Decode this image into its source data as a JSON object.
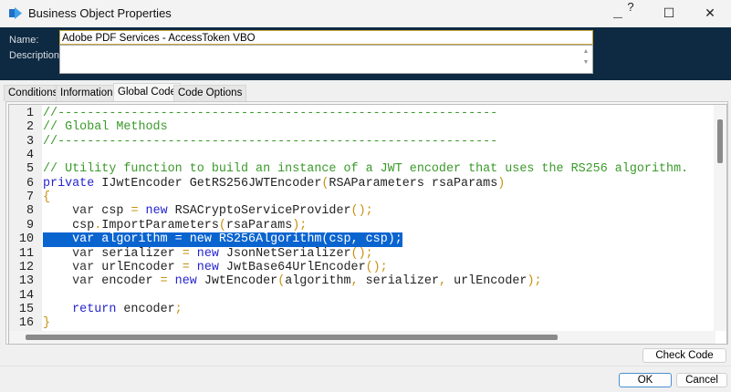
{
  "window": {
    "title": "Business Object Properties",
    "help": "?",
    "minimize": "—",
    "maximize": "☐",
    "close": "✕"
  },
  "header": {
    "name_label": "Name:",
    "description_label": "Description:",
    "name_value": "Adobe PDF Services - AccessToken VBO",
    "description_value": "",
    "desc_up": "▲",
    "desc_down": "▼"
  },
  "tabs": [
    {
      "label": "Conditions"
    },
    {
      "label": "Information"
    },
    {
      "label": "Global Code",
      "active": true
    },
    {
      "label": "Code Options"
    }
  ],
  "code": {
    "selected_line": 10,
    "lines": [
      [
        [
          "c",
          "//------------------------------------------------------------"
        ]
      ],
      [
        [
          "c",
          "// Global Methods"
        ]
      ],
      [
        [
          "c",
          "//------------------------------------------------------------"
        ]
      ],
      [],
      [
        [
          "c",
          "// Utility function to build an instance of a JWT encoder that uses the RS256 algorithm."
        ]
      ],
      [
        [
          "k",
          "private"
        ],
        [
          "i",
          " IJwtEncoder GetRS256JWTEncoder"
        ],
        [
          "o",
          "("
        ],
        [
          "i",
          "RSAParameters rsaParams"
        ],
        [
          "o",
          ")"
        ]
      ],
      [
        [
          "o",
          "{"
        ]
      ],
      [
        [
          "v",
          "    var"
        ],
        [
          "i",
          " csp "
        ],
        [
          "o",
          "="
        ],
        [
          "i",
          " "
        ],
        [
          "k",
          "new"
        ],
        [
          "i",
          " RSACryptoServiceProvider"
        ],
        [
          "o",
          "();"
        ]
      ],
      [
        [
          "i",
          "    csp"
        ],
        [
          "o",
          "."
        ],
        [
          "i",
          "ImportParameters"
        ],
        [
          "o",
          "("
        ],
        [
          "i",
          "rsaParams"
        ],
        [
          "o",
          ");"
        ]
      ],
      [
        [
          "v",
          "    var"
        ],
        [
          "i",
          " algorithm "
        ],
        [
          "o",
          "="
        ],
        [
          "i",
          " "
        ],
        [
          "k",
          "new"
        ],
        [
          "i",
          " RS256Algorithm"
        ],
        [
          "o",
          "("
        ],
        [
          "i",
          "csp"
        ],
        [
          "o",
          ","
        ],
        [
          "i",
          " csp"
        ],
        [
          "o",
          ");"
        ]
      ],
      [
        [
          "v",
          "    var"
        ],
        [
          "i",
          " serializer "
        ],
        [
          "o",
          "="
        ],
        [
          "i",
          " "
        ],
        [
          "k",
          "new"
        ],
        [
          "i",
          " JsonNetSerializer"
        ],
        [
          "o",
          "();"
        ]
      ],
      [
        [
          "v",
          "    var"
        ],
        [
          "i",
          " urlEncoder "
        ],
        [
          "o",
          "="
        ],
        [
          "i",
          " "
        ],
        [
          "k",
          "new"
        ],
        [
          "i",
          " JwtBase64UrlEncoder"
        ],
        [
          "o",
          "();"
        ]
      ],
      [
        [
          "v",
          "    var"
        ],
        [
          "i",
          " encoder "
        ],
        [
          "o",
          "="
        ],
        [
          "i",
          " "
        ],
        [
          "k",
          "new"
        ],
        [
          "i",
          " JwtEncoder"
        ],
        [
          "o",
          "("
        ],
        [
          "i",
          "algorithm"
        ],
        [
          "o",
          ","
        ],
        [
          "i",
          " serializer"
        ],
        [
          "o",
          ","
        ],
        [
          "i",
          " urlEncoder"
        ],
        [
          "o",
          ");"
        ]
      ],
      [],
      [
        [
          "k",
          "    return"
        ],
        [
          "i",
          " encoder"
        ],
        [
          "o",
          ";"
        ]
      ],
      [
        [
          "o",
          "}"
        ]
      ]
    ]
  },
  "buttons": {
    "check_code": "Check Code",
    "ok": "OK",
    "cancel": "Cancel"
  },
  "colors": {
    "header_bg": "#0e2a42",
    "selection": "#0a64d0",
    "comment": "#3a9a2a",
    "keyword": "#2424d0",
    "operator": "#c89010"
  }
}
